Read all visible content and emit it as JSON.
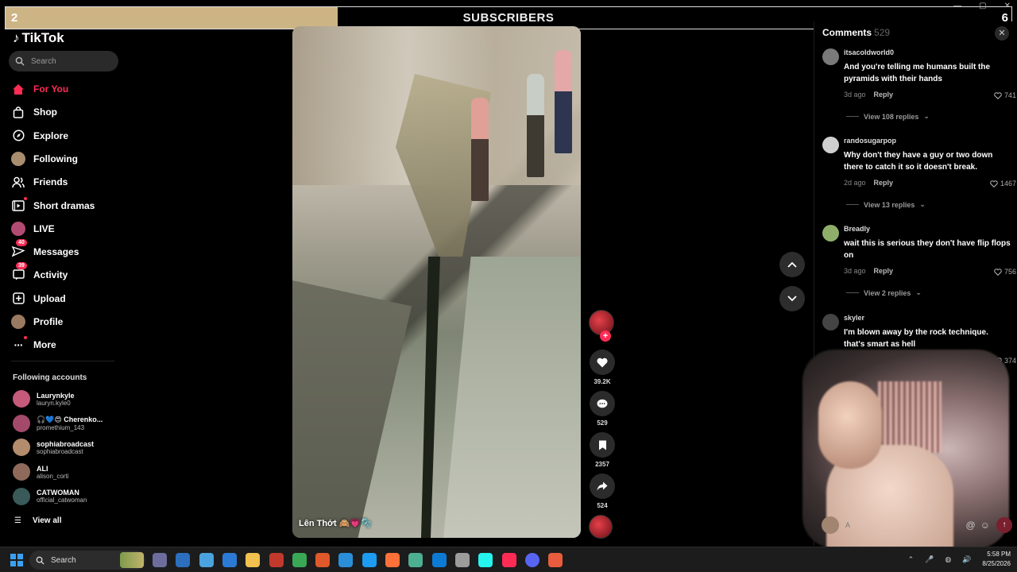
{
  "overlay": {
    "left_count": "2",
    "title": "SUBSCRIBERS",
    "right_count": "6",
    "progress_fraction": 0.33
  },
  "app": {
    "name": "TikTok"
  },
  "search": {
    "placeholder": "Search"
  },
  "nav": [
    {
      "label": "For You",
      "icon": "home-icon",
      "active": true
    },
    {
      "label": "Shop",
      "icon": "shopping-bag-icon"
    },
    {
      "label": "Explore",
      "icon": "compass-icon"
    },
    {
      "label": "Following",
      "icon": "following-avatar-icon"
    },
    {
      "label": "Friends",
      "icon": "friends-icon"
    },
    {
      "label": "Short dramas",
      "icon": "short-dramas-icon"
    },
    {
      "label": "LIVE",
      "icon": "live-avatar-icon"
    },
    {
      "label": "Messages",
      "icon": "messages-icon",
      "badge": "40"
    },
    {
      "label": "Activity",
      "icon": "activity-icon",
      "badge": "39"
    },
    {
      "label": "Upload",
      "icon": "upload-icon"
    },
    {
      "label": "Profile",
      "icon": "profile-avatar-icon"
    },
    {
      "label": "More",
      "icon": "more-icon"
    }
  ],
  "following_accounts": {
    "title": "Following accounts",
    "items": [
      {
        "name": "Laurynkyle",
        "handle": "lauryn.kyle0",
        "color": "#c55a7a"
      },
      {
        "name": "🎧💙😍 Cherenko...",
        "handle": "promethium_143",
        "color": "#a34a6a"
      },
      {
        "name": "sophiabroadcast",
        "handle": "sophiabroadcast",
        "color": "#b38b6d"
      },
      {
        "name": "ALI",
        "handle": "alison_corti",
        "color": "#8f6a5a"
      },
      {
        "name": "CATWOMAN",
        "handle": "official_catwoman",
        "color": "#3a5a5a"
      }
    ],
    "view_all": "View all"
  },
  "video": {
    "caption": "Lên Thớt 🙈💗🫧",
    "likes": "39.2K",
    "comments": "529",
    "saves": "2357",
    "shares": "524"
  },
  "comments": {
    "title": "Comments",
    "count": "529",
    "items": [
      {
        "user": "itsacoldworld0",
        "text": "And you're telling me humans built the pyramids with their hands",
        "time": "3d ago",
        "reply": "Reply",
        "likes": "741",
        "replies": "View 108 replies",
        "color": "#7a7a7a"
      },
      {
        "user": "randosugarpop",
        "text": "Why don't they have a guy or two down there to catch it so it doesn't break.",
        "time": "2d ago",
        "reply": "Reply",
        "likes": "1467",
        "replies": "View 13 replies",
        "color": "#cfcfcf"
      },
      {
        "user": "Breadly",
        "text": "wait this is serious they don't have flip flops on",
        "time": "3d ago",
        "reply": "Reply",
        "likes": "756",
        "replies": "View 2 replies",
        "color": "#8fae6a"
      },
      {
        "user": "skyler",
        "text": "I'm blown away by the rock technique. that's smart as hell",
        "time": "3d",
        "likes": "374",
        "color": "#444"
      }
    ],
    "input_placeholder": "A"
  },
  "taskbar": {
    "search_label": "Search",
    "time": "5:58 PM",
    "date": "8/25/2026"
  }
}
